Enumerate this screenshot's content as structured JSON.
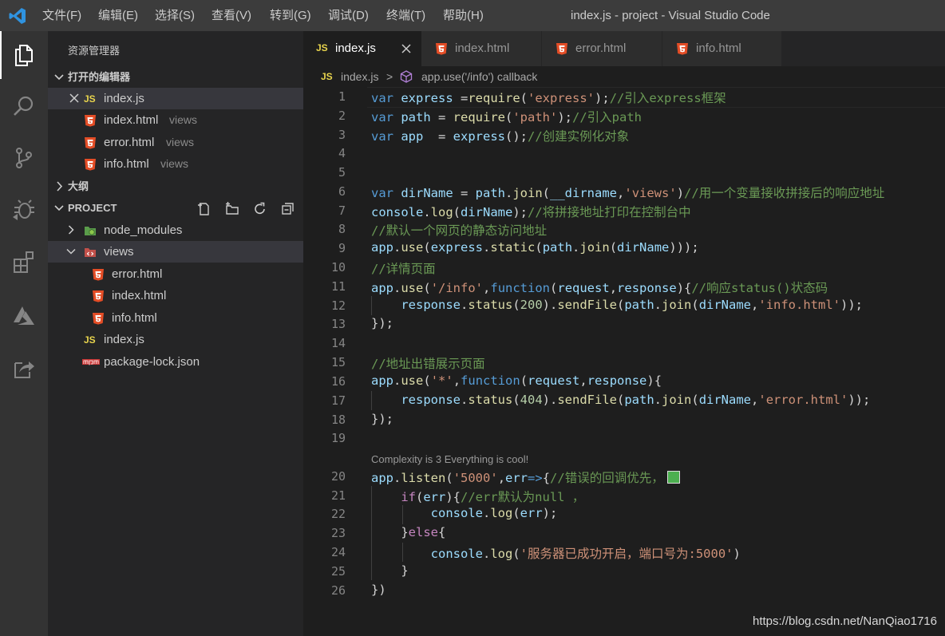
{
  "titlebar": {
    "menu": [
      "文件(F)",
      "编辑(E)",
      "选择(S)",
      "查看(V)",
      "转到(G)",
      "调试(D)",
      "终端(T)",
      "帮助(H)"
    ],
    "title": "index.js - project - Visual Studio Code"
  },
  "activitybar": {
    "icons": [
      "explorer-icon",
      "search-icon",
      "source-control-icon",
      "debug-icon",
      "extensions-icon",
      "azure-icon",
      "live-share-icon"
    ]
  },
  "sidebar": {
    "title": "资源管理器",
    "open_editors": {
      "header": "打开的编辑器",
      "items": [
        {
          "icon": "JS",
          "name": "index.js",
          "desc": "",
          "close": true
        },
        {
          "icon": "html",
          "name": "index.html",
          "desc": "views"
        },
        {
          "icon": "html",
          "name": "error.html",
          "desc": "views"
        },
        {
          "icon": "html",
          "name": "info.html",
          "desc": "views"
        }
      ]
    },
    "outline": {
      "header": "大纲"
    },
    "project": {
      "header": "PROJECT",
      "items": [
        {
          "name": "node_modules",
          "type": "folder"
        },
        {
          "name": "views",
          "type": "folder-open"
        },
        {
          "name": "error.html",
          "type": "html"
        },
        {
          "name": "index.html",
          "type": "html"
        },
        {
          "name": "info.html",
          "type": "html"
        },
        {
          "name": "index.js",
          "type": "js"
        },
        {
          "name": "package-lock.json",
          "type": "npm"
        }
      ]
    }
  },
  "tabs": [
    {
      "name": "index.js",
      "icon": "JS",
      "active": true
    },
    {
      "name": "index.html",
      "icon": "html"
    },
    {
      "name": "error.html",
      "icon": "html"
    },
    {
      "name": "info.html",
      "icon": "html"
    }
  ],
  "breadcrumb": {
    "file": "index.js",
    "separator": ">",
    "symbol": "app.use('/info') callback"
  },
  "editor": {
    "codelens": "Complexity is 3 Everything is cool!",
    "line_numbers": [
      "1",
      "2",
      "3",
      "4",
      "5",
      "6",
      "7",
      "8",
      "9",
      "10",
      "11",
      "12",
      "13",
      "14",
      "15",
      "16",
      "17",
      "18",
      "19",
      "20",
      "21",
      "22",
      "23",
      "24",
      "25",
      "26"
    ],
    "lines": [
      "var express =require('express');//引入express框架",
      "var path = require('path');//引入path",
      "var app  = express();//创建实例化对象",
      "",
      "",
      "var dirName = path.join(__dirname,'views')//用一个变量接收拼接后的响应地址",
      "console.log(dirName);//将拼接地址打印在控制台中",
      "//默认一个网页的静态访问地址",
      "app.use(express.static(path.join(dirName)));",
      "//详情页面",
      "app.use('/info',function(request,response){//响应status()状态码",
      "    response.status(200).sendFile(path.join(dirName,'info.html'));",
      "});",
      "",
      "//地址出错展示页面",
      "app.use('*',function(request,response){",
      "    response.status(404).sendFile(path.join(dirName,'error.html'));",
      "});",
      "",
      "app.listen('5000',err=>{//错误的回调优先，",
      "    if(err){//err默认为null ，",
      "        console.log(err);",
      "    }else{",
      "        console.log('服务器已成功开启，端口号为:5000')",
      "    }",
      "})"
    ]
  },
  "watermark": "https://blog.csdn.net/NanQiao1716"
}
